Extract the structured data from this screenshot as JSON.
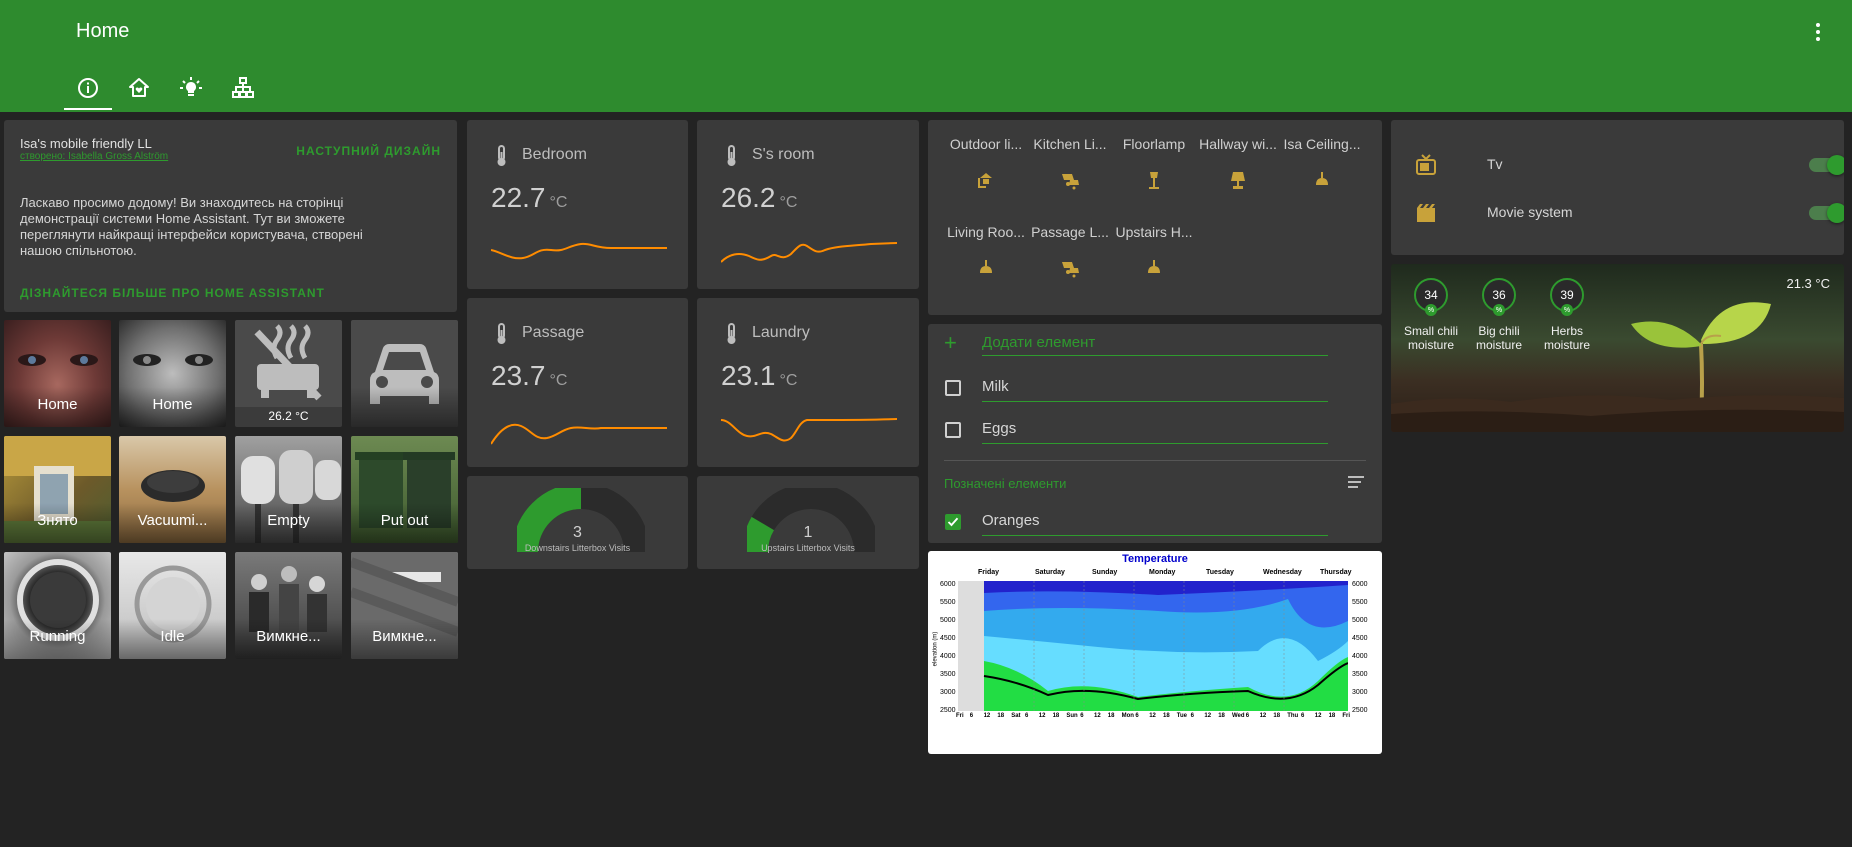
{
  "header": {
    "title": "Home",
    "tabs": [
      {
        "icon": "info-icon"
      },
      {
        "icon": "home-heart-icon"
      },
      {
        "icon": "lightbulb-icon"
      },
      {
        "icon": "network-icon"
      }
    ],
    "menu_icon": "dots-vertical-icon"
  },
  "welcome": {
    "title": "Isa's mobile friendly LL",
    "subtitle": "створено: Isabella Gross Alström",
    "next_label": "НАСТУПНИЙ ДИЗАЙН",
    "body": "Ласкаво просимо додому! Ви знаходитесь на сторінці демонстрації системи Home Assistant. Тут ви зможете переглянути найкращі інтерфейси користувача, створені нашою спільнотою.",
    "more_label": "ДІЗНАЙТЕСЯ БІЛЬШЕ ПРО HOME ASSISTANT"
  },
  "tiles": [
    {
      "label": "Home"
    },
    {
      "label": "Home"
    },
    {
      "label": "26.2 °C",
      "icon": "radiator-off-icon"
    },
    {
      "label": "",
      "icon": "car-icon"
    },
    {
      "label": "Знято"
    },
    {
      "label": "Vacuumi..."
    },
    {
      "label": "Empty"
    },
    {
      "label": "Put out"
    },
    {
      "label": "Running"
    },
    {
      "label": "Idle"
    },
    {
      "label": "Вимкне..."
    },
    {
      "label": "Вимкне..."
    }
  ],
  "sensors": [
    {
      "name": "Bedroom",
      "value": "22.7",
      "unit": "°C"
    },
    {
      "name": "S's room",
      "value": "26.2",
      "unit": "°C"
    },
    {
      "name": "Passage",
      "value": "23.7",
      "unit": "°C"
    },
    {
      "name": "Laundry",
      "value": "23.1",
      "unit": "°C"
    }
  ],
  "gauges": [
    {
      "value": "3",
      "label": "Downstairs Litterbox Visits",
      "fraction": 0.5
    },
    {
      "value": "1",
      "label": "Upstairs Litterbox Visits",
      "fraction": 0.17
    }
  ],
  "lights": [
    {
      "name": "Outdoor li...",
      "icon": "outdoor-lamp-icon"
    },
    {
      "name": "Kitchen Li...",
      "icon": "ceiling-light-multiple-icon"
    },
    {
      "name": "Floorlamp",
      "icon": "floor-lamp-icon"
    },
    {
      "name": "Hallway wi...",
      "icon": "lamp-icon"
    },
    {
      "name": "Isa Ceiling...",
      "icon": "ceiling-light-icon"
    },
    {
      "name": "Living Roo...",
      "icon": "ceiling-light-icon"
    },
    {
      "name": "Passage L...",
      "icon": "ceiling-light-multiple-icon"
    },
    {
      "name": "Upstairs H...",
      "icon": "ceiling-light-icon"
    }
  ],
  "shopping": {
    "add_placeholder": "Додати елемент",
    "items": [
      {
        "name": "Milk",
        "checked": false
      },
      {
        "name": "Eggs",
        "checked": false
      }
    ],
    "checked_title": "Позначені елементи",
    "checked_items": [
      {
        "name": "Oranges",
        "checked": true
      }
    ]
  },
  "switches": [
    {
      "name": "Tv",
      "icon": "television-classic-icon",
      "on": true
    },
    {
      "name": "Movie system",
      "icon": "movie-icon",
      "on": true
    }
  ],
  "plant": {
    "temperature": "21.3 °C",
    "sensors": [
      {
        "value": "34",
        "unit": "%",
        "name_line1": "Small chili",
        "name_line2": "moisture"
      },
      {
        "value": "36",
        "unit": "%",
        "name_line1": "Big chili",
        "name_line2": "moisture"
      },
      {
        "value": "39",
        "unit": "%",
        "name_line1": "Herbs",
        "name_line2": "moisture"
      }
    ]
  },
  "temperature_image": {
    "title": "Temperature",
    "days": [
      "Friday",
      "Saturday",
      "Sunday",
      "Monday",
      "Tuesday",
      "Wednesday",
      "Thursday"
    ],
    "y_ticks": [
      "6000",
      "5500",
      "5000",
      "4500",
      "4000",
      "3500",
      "3000",
      "2500"
    ],
    "y_label": "elevation (m)",
    "x_ticks": [
      "Fri",
      "6",
      "12",
      "18",
      "Sat",
      "6",
      "12",
      "18",
      "Sun",
      "6",
      "12",
      "18",
      "Mon",
      "6",
      "12",
      "18",
      "Tue",
      "6",
      "12",
      "18",
      "Wed",
      "6",
      "12",
      "18",
      "Thu",
      "6",
      "12",
      "18",
      "Fri"
    ]
  },
  "colors": {
    "primary": "#2e8b2e",
    "accent": "#2e9b2e",
    "spark": "#ff8c00",
    "card": "#3a3a3a",
    "background": "#232323",
    "light_icon": "#c8a23a"
  }
}
